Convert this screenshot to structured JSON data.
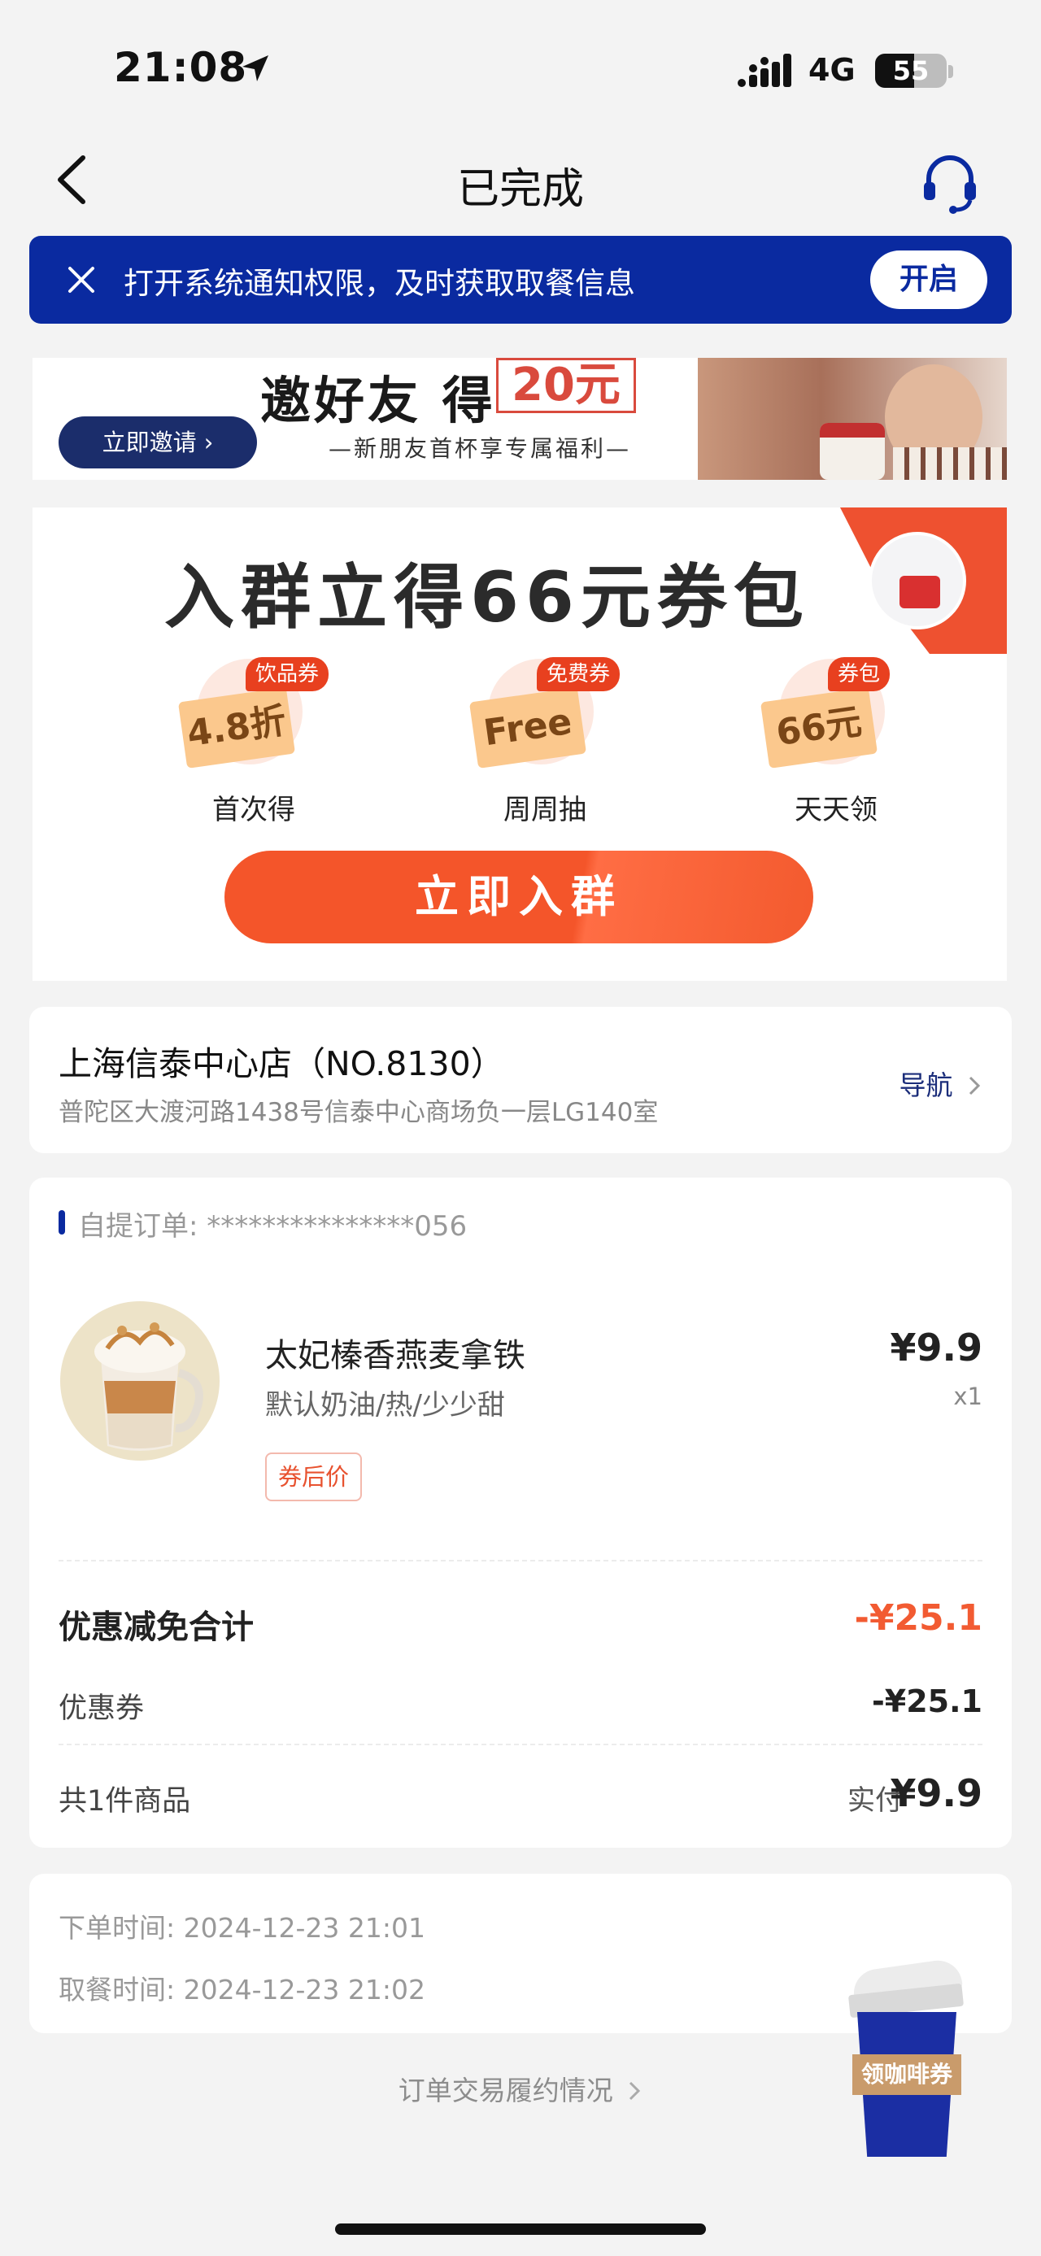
{
  "status_bar": {
    "time": "21:08",
    "network": "4G",
    "battery": "55"
  },
  "nav": {
    "title": "已完成",
    "back_icon": "chevron-left-icon",
    "service_icon": "headset-icon"
  },
  "notice": {
    "text": "打开系统通知权限，及时获取取餐信息",
    "button": "开启"
  },
  "invite_banner": {
    "headline": "邀好友 得",
    "amount": "20元",
    "subtitle": "—新朋友首杯享专属福利—",
    "button": "立即邀请"
  },
  "group_promo": {
    "title": "入群立得66元券包",
    "perks": [
      {
        "tag": "饮品券",
        "ticket": "4.8折",
        "label": "首次得"
      },
      {
        "tag": "免费券",
        "ticket": "Free",
        "label": "周周抽"
      },
      {
        "tag": "券包",
        "ticket": "66元",
        "label": "天天领"
      }
    ],
    "button": "立即入群"
  },
  "store": {
    "name": "上海信泰中心店（NO.8130）",
    "address": "普陀区大渡河路1438号信泰中心商场负一层LG140室",
    "nav_label": "导航"
  },
  "order": {
    "order_id": "自提订单: ***************056",
    "item": {
      "name": "太妃榛香燕麦拿铁",
      "spec": "默认奶油/热/少少甜",
      "tag": "券后价",
      "price": "¥9.9",
      "qty": "x1"
    },
    "discount_title": "优惠减免合计",
    "discount_total": "-¥25.1",
    "coupon_label": "优惠券",
    "coupon_value": "-¥25.1",
    "count_label": "共1件商品",
    "paid_label": "实付",
    "paid_value": "¥9.9"
  },
  "times": {
    "order_time": "下单时间:  2024-12-23 21:01",
    "pickup_time": "取餐时间:  2024-12-23 21:02"
  },
  "footer": {
    "fulfill_link": "订单交易履约情况"
  },
  "fab": {
    "label": "领咖啡券"
  },
  "colors": {
    "primary_blue": "#0a2aa0",
    "accent_orange": "#f4552a",
    "price_red": "#f25b32"
  }
}
